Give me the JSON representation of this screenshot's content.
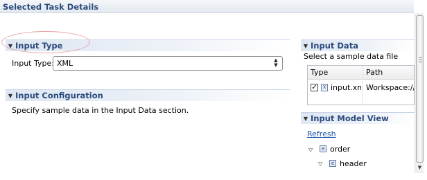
{
  "title": "Selected Task Details",
  "input_type_section": {
    "header": "Input Type",
    "field_label": "Input Type:",
    "selected_value": "XML"
  },
  "input_configuration_section": {
    "header": "Input Configuration",
    "text": "Specify sample data in the Input Data section."
  },
  "input_data_section": {
    "header": "Input Data",
    "subtitle": "Select a sample data file",
    "columns": [
      "Type",
      "Path"
    ],
    "rows": [
      {
        "checked": true,
        "type": "input.xml",
        "path": "Workspace://x"
      }
    ]
  },
  "input_model_view_section": {
    "header": "Input Model View",
    "refresh_label": "Refresh",
    "tree": [
      {
        "label": "order",
        "icon": "e"
      },
      {
        "label": "header",
        "icon": "e"
      }
    ]
  },
  "icons": {
    "expanded_twisty": "triangle-down-icon",
    "file_icon": "xml-file-icon",
    "element_icon": "element-e-icon"
  },
  "colors": {
    "header_text": "#2b4b7c",
    "link": "#1b52a6",
    "highlight_ellipse": "#e9a3a8"
  }
}
